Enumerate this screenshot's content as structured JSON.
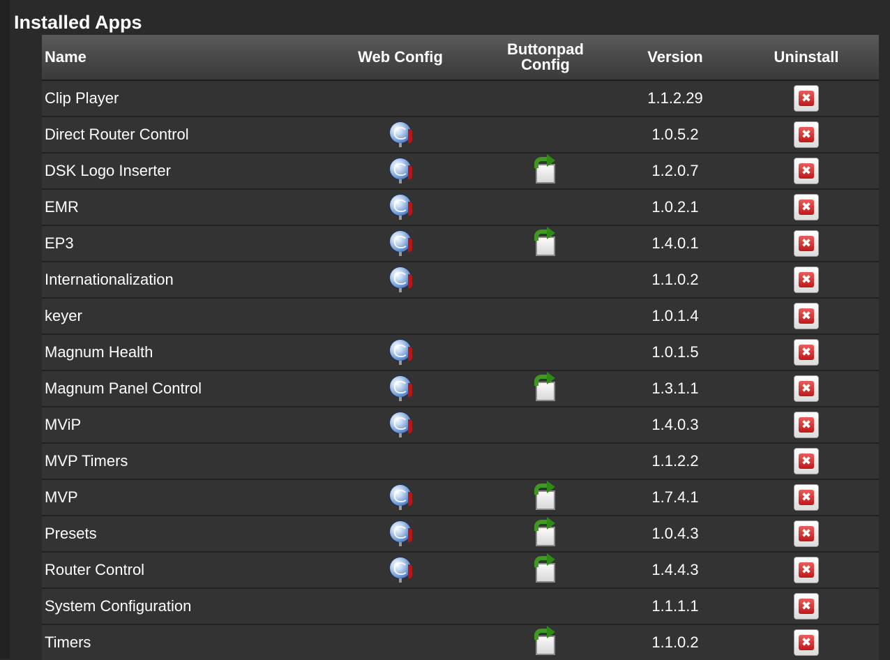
{
  "title": "Installed Apps",
  "columns": {
    "name": "Name",
    "web_config": "Web Config",
    "buttonpad_line1": "Buttonpad",
    "buttonpad_line2": "Config",
    "version": "Version",
    "uninstall": "Uninstall"
  },
  "icons": {
    "web_config": "globe-icon",
    "buttonpad_config": "buttonpad-config-icon",
    "uninstall": "delete-icon",
    "uninstall_glyph": "✖"
  },
  "apps": [
    {
      "name": "Clip Player",
      "web_config": false,
      "buttonpad_config": false,
      "version": "1.1.2.29"
    },
    {
      "name": "Direct Router Control",
      "web_config": true,
      "buttonpad_config": false,
      "version": "1.0.5.2"
    },
    {
      "name": "DSK Logo Inserter",
      "web_config": true,
      "buttonpad_config": true,
      "version": "1.2.0.7"
    },
    {
      "name": "EMR",
      "web_config": true,
      "buttonpad_config": false,
      "version": "1.0.2.1"
    },
    {
      "name": "EP3",
      "web_config": true,
      "buttonpad_config": true,
      "version": "1.4.0.1"
    },
    {
      "name": "Internationalization",
      "web_config": true,
      "buttonpad_config": false,
      "version": "1.1.0.2"
    },
    {
      "name": "keyer",
      "web_config": false,
      "buttonpad_config": false,
      "version": "1.0.1.4"
    },
    {
      "name": "Magnum Health",
      "web_config": true,
      "buttonpad_config": false,
      "version": "1.0.1.5"
    },
    {
      "name": "Magnum Panel Control",
      "web_config": true,
      "buttonpad_config": true,
      "version": "1.3.1.1"
    },
    {
      "name": "MViP",
      "web_config": true,
      "buttonpad_config": false,
      "version": "1.4.0.3"
    },
    {
      "name": "MVP Timers",
      "web_config": false,
      "buttonpad_config": false,
      "version": "1.1.2.2"
    },
    {
      "name": "MVP",
      "web_config": true,
      "buttonpad_config": true,
      "version": "1.7.4.1"
    },
    {
      "name": "Presets",
      "web_config": true,
      "buttonpad_config": true,
      "version": "1.0.4.3"
    },
    {
      "name": "Router Control",
      "web_config": true,
      "buttonpad_config": true,
      "version": "1.4.4.3"
    },
    {
      "name": "System Configuration",
      "web_config": false,
      "buttonpad_config": false,
      "version": "1.1.1.1"
    },
    {
      "name": "Timers",
      "web_config": false,
      "buttonpad_config": true,
      "version": "1.1.0.2"
    }
  ]
}
